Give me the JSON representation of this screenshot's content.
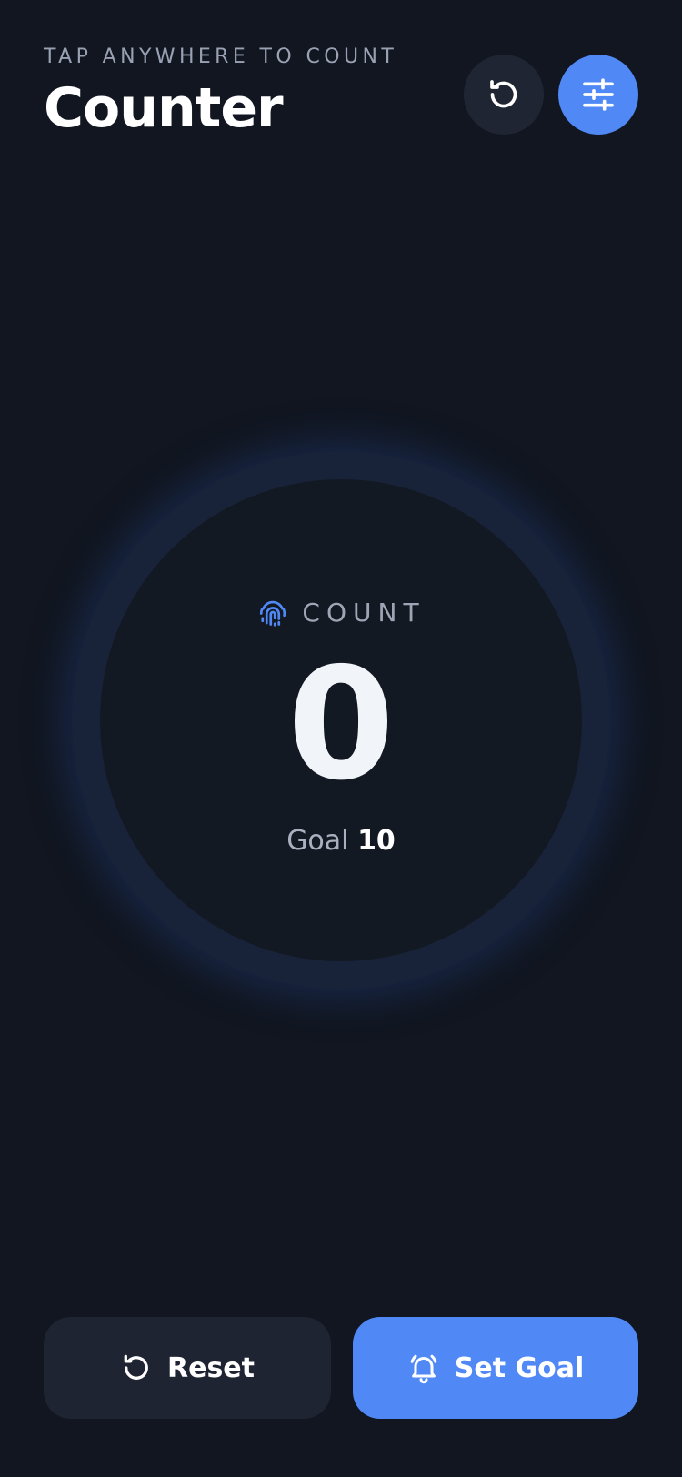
{
  "header": {
    "subtitle": "TAP ANYWHERE TO COUNT",
    "title": "Counter"
  },
  "counter": {
    "label": "COUNT",
    "value": "0",
    "goal_label": "Goal",
    "goal_value": "10"
  },
  "actions": {
    "reset_label": "Reset",
    "set_goal_label": "Set Goal"
  },
  "icons": {
    "history": "history-icon",
    "settings": "sliders-icon",
    "count": "fingerprint-icon",
    "reset": "reset-icon",
    "goal": "bell-icon"
  },
  "colors": {
    "background": "#111620",
    "accent": "#5089f6",
    "ring": "#18233a",
    "button_dark": "#1f2432"
  }
}
